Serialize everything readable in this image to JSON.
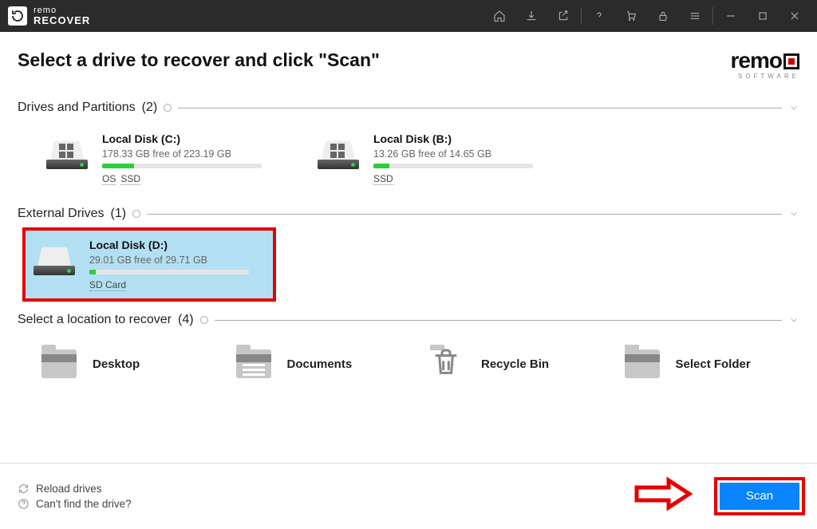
{
  "app": {
    "brand_small": "remo",
    "brand_big": "RECOVER",
    "brand_sub": "SOFTWARE"
  },
  "page_title": "Select a drive to recover and click \"Scan\"",
  "sections": {
    "drives_label": "Drives and Partitions",
    "drives_count": "(2)",
    "external_label": "External Drives",
    "external_count": "(1)",
    "locations_label": "Select a location to recover",
    "locations_count": "(4)"
  },
  "drives": [
    {
      "name": "Local Disk (C:)",
      "free_text": "178.33 GB free of 223.19 GB",
      "used_percent": 20,
      "tags": [
        "OS",
        "SSD"
      ],
      "os_icon": true
    },
    {
      "name": "Local Disk (B:)",
      "free_text": "13.26 GB free of 14.65 GB",
      "used_percent": 10,
      "tags": [
        "SSD"
      ],
      "os_icon": true
    }
  ],
  "external": [
    {
      "name": "Local Disk (D:)",
      "free_text": "29.01 GB free of 29.71 GB",
      "used_percent": 4,
      "tags": [
        "SD Card"
      ],
      "selected": true
    }
  ],
  "locations": [
    {
      "label": "Desktop",
      "kind": "folder"
    },
    {
      "label": "Documents",
      "kind": "docs"
    },
    {
      "label": "Recycle Bin",
      "kind": "trash"
    },
    {
      "label": "Select Folder",
      "kind": "folder"
    }
  ],
  "footer": {
    "reload": "Reload drives",
    "help": "Can't find the drive?",
    "scan": "Scan"
  }
}
